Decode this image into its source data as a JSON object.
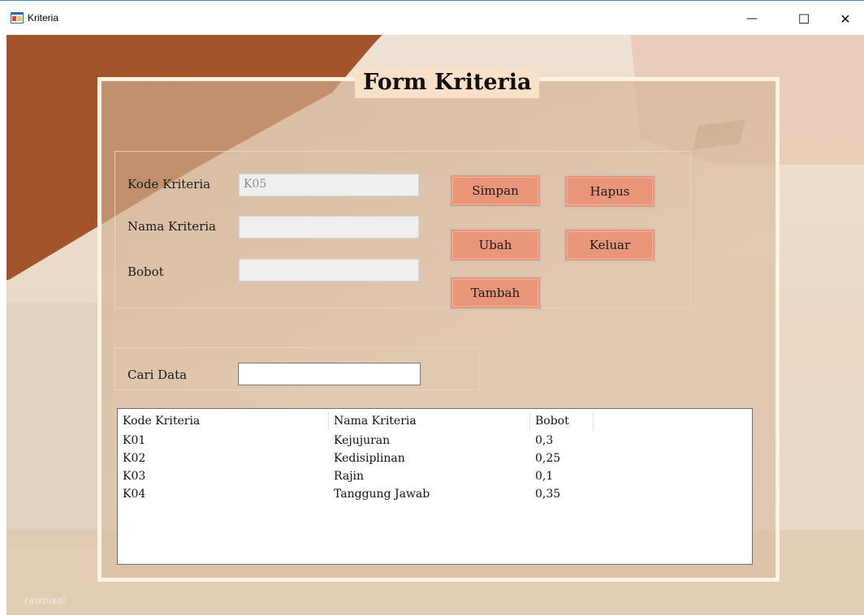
{
  "window": {
    "title": "Kriteria",
    "minimize_glyph": "—",
    "maximize_glyph": "☐",
    "close_glyph": "✕"
  },
  "form": {
    "heading": "Form Kriteria",
    "kode_label": "Kode Kriteria",
    "kode_value": "K05",
    "nama_label": "Nama Kriteria",
    "nama_value": "",
    "bobot_label": "Bobot",
    "bobot_value": "",
    "search_label": "Cari Data",
    "search_value": ""
  },
  "buttons": {
    "simpan": "Simpan",
    "hapus": "Hapus",
    "ubah": "Ubah",
    "keluar": "Keluar",
    "tambah": "Tambah"
  },
  "table": {
    "columns": [
      "Kode Kriteria",
      "Nama Kriteria",
      "Bobot"
    ],
    "rows": [
      [
        "K01",
        "Kejujuran",
        "0,3"
      ],
      [
        "K02",
        "Kedisiplinan",
        "0,25"
      ],
      [
        "K03",
        "Rajin",
        "0,1"
      ],
      [
        "K04",
        "Tanggung Jawab",
        "0,35"
      ]
    ]
  },
  "watermark": "rawpixel",
  "colors": {
    "button": "#e8957a",
    "heading_bg": "#f9e0c9",
    "brown_shape": "#a3542a"
  }
}
